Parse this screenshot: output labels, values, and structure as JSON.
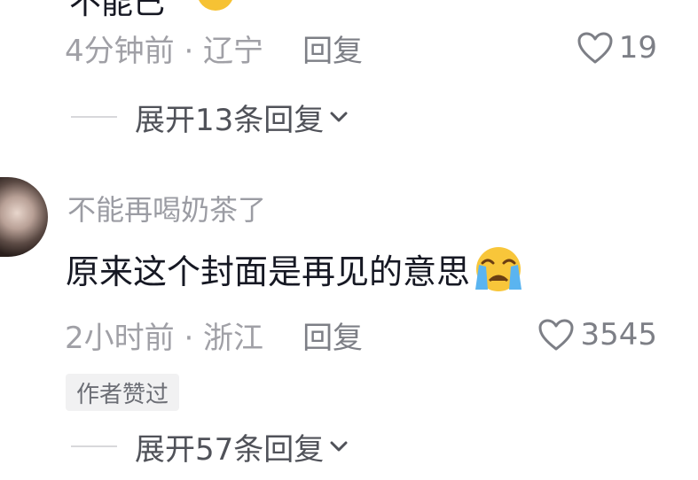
{
  "top_comment": {
    "cutoff_text": "不能已",
    "time_location": "4分钟前 · 辽宁",
    "reply_label": "回复",
    "like_count": "19",
    "expand_label": "展开13条回复"
  },
  "comment": {
    "username": "不能再喝奶茶了",
    "text": "原来这个封面是再见的意思",
    "emoji": "crying-face-emoji",
    "time_location": "2小时前 · 浙江",
    "reply_label": "回复",
    "like_count": "3545",
    "badge": "作者赞过",
    "expand_label": "展开57条回复"
  },
  "colors": {
    "primary_text": "#161823",
    "secondary_text": "#a0a0a6",
    "badge_bg": "#f1f1f2"
  }
}
